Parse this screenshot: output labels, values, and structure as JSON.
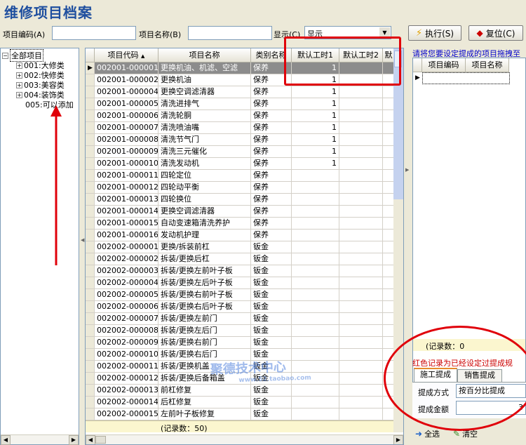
{
  "window": {
    "title": "维修项目档案"
  },
  "toolbar": {
    "code_label": "项目编码(A)",
    "code_value": "",
    "name_label": "项目名称(B)",
    "name_value": "",
    "show_label": "显示(C)",
    "show_value": "显示",
    "exec_label": "执行(S)",
    "reset_label": "复位(C)"
  },
  "tree": {
    "root": "全部项目",
    "items": [
      {
        "label": "001:大修类"
      },
      {
        "label": "002:快修类"
      },
      {
        "label": "003:美容类"
      },
      {
        "label": "004:装饰类"
      },
      {
        "label": "005:可以添加"
      }
    ]
  },
  "grid": {
    "columns": [
      "项目代码",
      "项目名称",
      "类别名称",
      "默认工时1",
      "默认工时2",
      "默"
    ],
    "rows": [
      {
        "code": "002001-000001",
        "name": "更换机油、机滤、空滤",
        "cat": "保养",
        "h1": "1"
      },
      {
        "code": "002001-000002",
        "name": "更换机油",
        "cat": "保养",
        "h1": "1"
      },
      {
        "code": "002001-000004",
        "name": "更换空调滤清器",
        "cat": "保养",
        "h1": "1"
      },
      {
        "code": "002001-000005",
        "name": "清洗进排气",
        "cat": "保养",
        "h1": "1"
      },
      {
        "code": "002001-000006",
        "name": "清洗轮胴",
        "cat": "保养",
        "h1": "1"
      },
      {
        "code": "002001-000007",
        "name": "清洗喷油嘴",
        "cat": "保养",
        "h1": "1"
      },
      {
        "code": "002001-000008",
        "name": "清洗节气门",
        "cat": "保养",
        "h1": "1"
      },
      {
        "code": "002001-000009",
        "name": "清洗三元催化",
        "cat": "保养",
        "h1": "1"
      },
      {
        "code": "002001-000010",
        "name": "清洗发动机",
        "cat": "保养",
        "h1": "1"
      },
      {
        "code": "002001-000011",
        "name": "四轮定位",
        "cat": "保养",
        "h1": ""
      },
      {
        "code": "002001-000012",
        "name": "四轮动平衡",
        "cat": "保养",
        "h1": ""
      },
      {
        "code": "002001-000013",
        "name": "四轮换位",
        "cat": "保养",
        "h1": ""
      },
      {
        "code": "002001-000014",
        "name": "更换空调滤清器",
        "cat": "保养",
        "h1": ""
      },
      {
        "code": "002001-000015",
        "name": "自动变速箱清洗养护",
        "cat": "保养",
        "h1": ""
      },
      {
        "code": "002001-000016",
        "name": "发动机护理",
        "cat": "保养",
        "h1": ""
      },
      {
        "code": "002002-000001",
        "name": "更换/拆装前杠",
        "cat": "钣金",
        "h1": ""
      },
      {
        "code": "002002-000002",
        "name": "拆装/更换后杠",
        "cat": "钣金",
        "h1": ""
      },
      {
        "code": "002002-000003",
        "name": "拆装/更换左前叶子板",
        "cat": "钣金",
        "h1": ""
      },
      {
        "code": "002002-000004",
        "name": "拆装/更换左后叶子板",
        "cat": "钣金",
        "h1": ""
      },
      {
        "code": "002002-000005",
        "name": "拆装/更换右前叶子板",
        "cat": "钣金",
        "h1": ""
      },
      {
        "code": "002002-000006",
        "name": "拆装/更换右后叶子板",
        "cat": "钣金",
        "h1": ""
      },
      {
        "code": "002002-000007",
        "name": "拆装/更换左前门",
        "cat": "钣金",
        "h1": ""
      },
      {
        "code": "002002-000008",
        "name": "拆装/更换左后门",
        "cat": "钣金",
        "h1": ""
      },
      {
        "code": "002002-000009",
        "name": "拆装/更换右前门",
        "cat": "钣金",
        "h1": ""
      },
      {
        "code": "002002-000010",
        "name": "拆装/更换右后门",
        "cat": "钣金",
        "h1": ""
      },
      {
        "code": "002002-000011",
        "name": "拆装/更换机盖",
        "cat": "钣金",
        "h1": ""
      },
      {
        "code": "002002-000012",
        "name": "拆装/更换后备箱盖",
        "cat": "钣金",
        "h1": ""
      },
      {
        "code": "002002-000013",
        "name": "前杠修复",
        "cat": "钣金",
        "h1": ""
      },
      {
        "code": "002002-000014",
        "name": "后杠修复",
        "cat": "钣金",
        "h1": ""
      },
      {
        "code": "002002-000015",
        "name": "左前叶子板修复",
        "cat": "钣金",
        "h1": ""
      }
    ],
    "footer": "(记录数：50)"
  },
  "right": {
    "hint": "请将您要设定提成的项目拖拽至",
    "columns": [
      "项目编码",
      "项目名称"
    ],
    "footer": "(记录数：0",
    "red_note": "红色记录为已经设定过提成规",
    "tabs": [
      "施工提成",
      "销售提成"
    ],
    "method_label": "提成方式",
    "method_value": "按百分比提成",
    "amount_label": "提成金额",
    "amount_value": "3",
    "select_all": "全选",
    "clear": "清空"
  },
  "watermark": {
    "text": "聚德技术中心",
    "sub": "www.52.taobao.com"
  },
  "colors": {
    "title": "#1f4f9f",
    "selected_row": "#8c8c8c",
    "annotation": "#e0000a",
    "hint": "#0000cc",
    "red_note": "#cc0000"
  }
}
